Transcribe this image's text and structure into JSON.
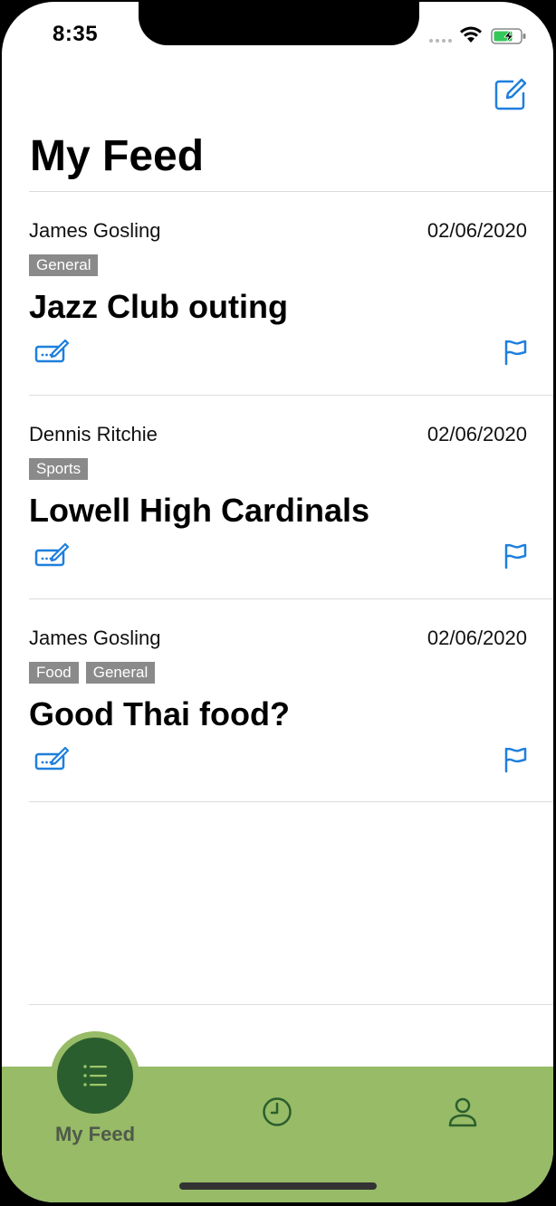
{
  "status_bar": {
    "time": "8:35"
  },
  "header": {
    "title": "My Feed",
    "compose_icon": "compose-icon"
  },
  "posts": [
    {
      "author": "James Gosling",
      "date": "02/06/2020",
      "tags": [
        "General"
      ],
      "title": "Jazz Club outing"
    },
    {
      "author": "Dennis Ritchie",
      "date": "02/06/2020",
      "tags": [
        "Sports"
      ],
      "title": "Lowell High Cardinals"
    },
    {
      "author": "James Gosling",
      "date": "02/06/2020",
      "tags": [
        "Food",
        "General"
      ],
      "title": "Good Thai food?"
    }
  ],
  "tab_bar": {
    "items": [
      {
        "label": "My Feed",
        "icon": "list-icon",
        "active": true
      },
      {
        "label": "",
        "icon": "clock-icon",
        "active": false
      },
      {
        "label": "",
        "icon": "person-icon",
        "active": false
      }
    ]
  },
  "colors": {
    "accent_blue": "#1f7fdd",
    "tab_bar_green": "#97bb66",
    "active_tab_dark_green": "#2b5e2e",
    "tag_gray": "#8a8a8a"
  }
}
